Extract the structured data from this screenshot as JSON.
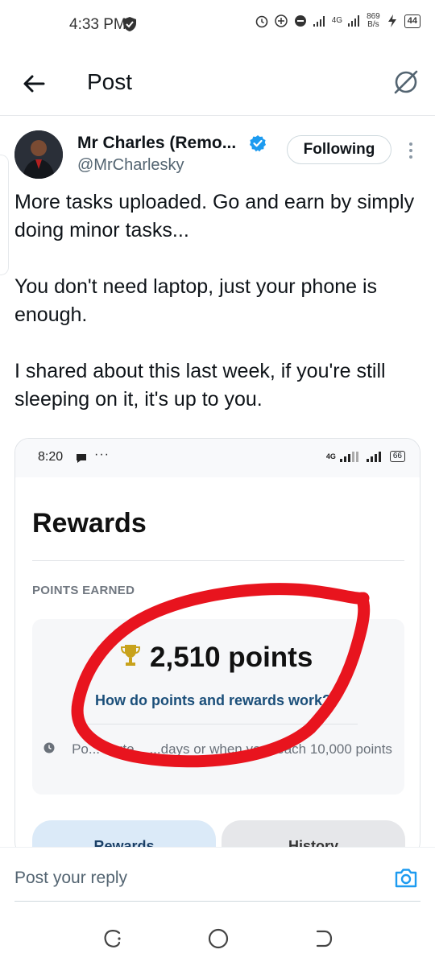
{
  "status_bar": {
    "time": "4:33 PM",
    "network_type": "4G",
    "speed_value": "869",
    "speed_unit": "B/s",
    "battery": "44"
  },
  "header": {
    "title": "Post"
  },
  "post": {
    "author_name": "Mr Charles (Remo...",
    "author_handle": "@MrCharlesky",
    "follow_label": "Following",
    "text_lines": [
      "More tasks uploaded. Go and earn by simply doing minor tasks...",
      "You don't need laptop, just your phone is enough.",
      "I shared about this last week, if you're still sleeping on it, it's up to you."
    ]
  },
  "media": {
    "status_time": "8:20",
    "status_network": "4G",
    "status_battery": "66",
    "title": "Rewards",
    "section_label": "POINTS EARNED",
    "points": "2,510 points",
    "how_link": "How do points and rewards work?",
    "expiry_text": "Po...  ...ute...  ...days or when you reach 10,000 points",
    "tabs": [
      "Rewards",
      "History"
    ],
    "annotation_color": "#e8141e"
  },
  "reply": {
    "placeholder": "Post your reply"
  },
  "colors": {
    "accent": "#1d9bf0",
    "text": "#0f1419",
    "secondary": "#536471"
  }
}
